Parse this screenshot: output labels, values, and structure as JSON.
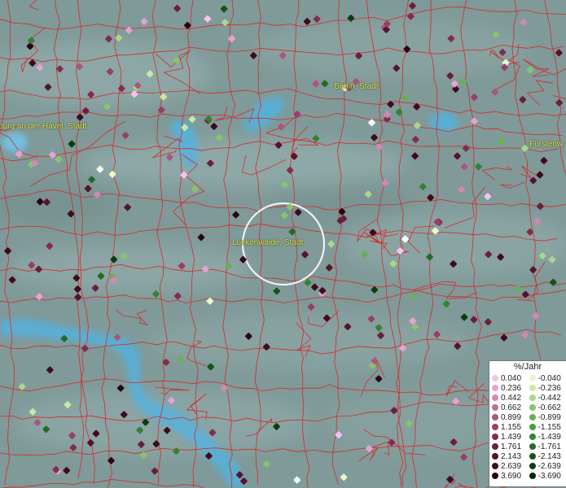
{
  "places": [
    {
      "name": "burg an der Havel, Stadt"
    },
    {
      "name": "Berlin, Stadt"
    },
    {
      "name": "Fürstenw"
    },
    {
      "name": "Luckenwalde, Stadt"
    }
  ],
  "legend": {
    "title": "%/Jahr",
    "positive": [
      {
        "label": "0.040",
        "color": "#f5c2ee"
      },
      {
        "label": "0.236",
        "color": "#e8a2cf"
      },
      {
        "label": "0.442",
        "color": "#d487b2"
      },
      {
        "label": "0.662",
        "color": "#c06b96"
      },
      {
        "label": "0.899",
        "color": "#ad557d"
      },
      {
        "label": "1.155",
        "color": "#974065"
      },
      {
        "label": "1.439",
        "color": "#822d50"
      },
      {
        "label": "1.761",
        "color": "#6c1d3c"
      },
      {
        "label": "2.143",
        "color": "#57122c"
      },
      {
        "label": "2.639",
        "color": "#400a1e"
      },
      {
        "label": "3.690",
        "color": "#2a0612"
      }
    ],
    "negative": [
      {
        "label": "-0.040",
        "color": "#eaf7c8"
      },
      {
        "label": "-0.236",
        "color": "#c9e8a6"
      },
      {
        "label": "-0.442",
        "color": "#a8d88a"
      },
      {
        "label": "-0.662",
        "color": "#86c46e"
      },
      {
        "label": "-0.899",
        "color": "#66b055"
      },
      {
        "label": "-1.155",
        "color": "#4a9a42"
      },
      {
        "label": "-1.439",
        "color": "#358233"
      },
      {
        "label": "-1.761",
        "color": "#246a26"
      },
      {
        "label": "-2.143",
        "color": "#15531a"
      },
      {
        "label": "-2.639",
        "color": "#0b3d10"
      },
      {
        "label": "-3.690",
        "color": "#052808"
      }
    ]
  },
  "colors": {
    "background": "#7f9a99",
    "border": "#d62a2a",
    "water": "#4fb4e4",
    "label": "#e6e24a",
    "highlight": "#ffffff"
  },
  "symbols": [
    {
      "color": "dark-red"
    },
    {
      "color": "dark-red"
    },
    {
      "color": "dark-red"
    },
    {
      "color": "dark-red"
    },
    {
      "color": "maroon"
    },
    {
      "color": "pink"
    },
    {
      "color": "white"
    },
    {
      "color": "green"
    },
    {
      "color": "dark-green"
    },
    {
      "color": "light-green"
    },
    {
      "color": "light-pink"
    }
  ]
}
